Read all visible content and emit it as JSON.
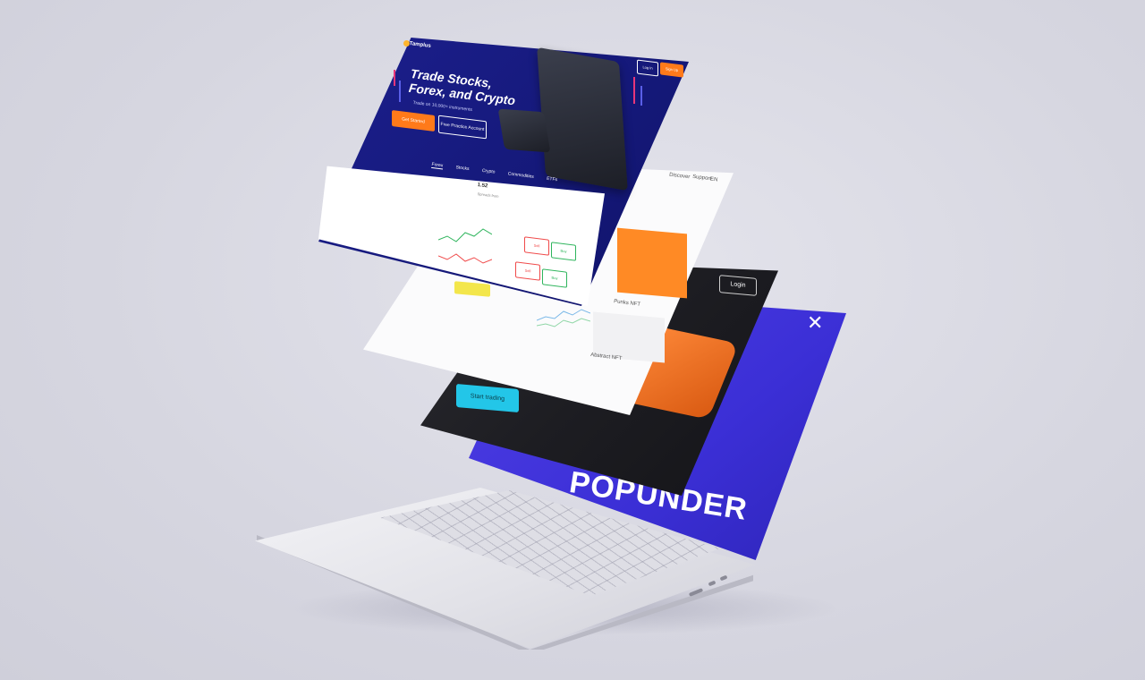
{
  "trading_page": {
    "brand": "Tamplus",
    "headline": "Trade Stocks, Forex, and Crypto",
    "subtext": "Trade on 10,000+ instruments",
    "cta_primary": "Get Started",
    "cta_secondary": "Free Practice Account",
    "login_label": "Log In",
    "signup_label": "Sign Up",
    "tabs": [
      "Forex",
      "Stocks",
      "Crypto",
      "Commodities",
      "ETFs"
    ],
    "stat_value": "1.52",
    "stat_label": "Spreads from",
    "trade_buttons": [
      "Sell",
      "Buy",
      "Sell",
      "Buy"
    ],
    "colors": {
      "brand": "#1c1f8d",
      "accent": "#ff7a1a"
    }
  },
  "nft_page": {
    "nav_items": [
      "Discover",
      "Support",
      "EN"
    ],
    "card_label": "Punks NFT",
    "card2_label": "Abstract NFT"
  },
  "dark_page": {
    "cta": "Start trading",
    "login_label": "Login"
  },
  "popunder": {
    "title": "POPUNDER",
    "close_icon": "close-icon",
    "color": "#3b2fd6"
  }
}
